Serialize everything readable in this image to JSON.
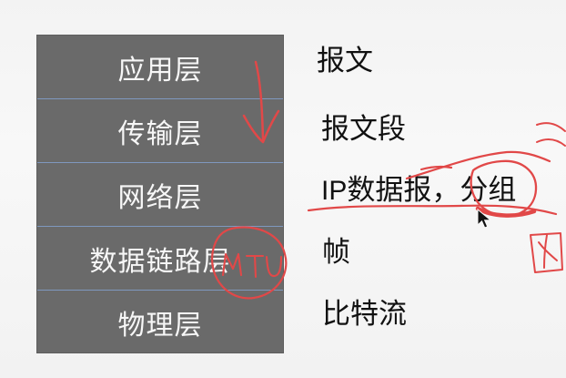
{
  "diagram": {
    "layers": [
      {
        "name": "应用层",
        "unit_text": "报文"
      },
      {
        "name": "传输层",
        "unit_text": "报文段"
      },
      {
        "name": "网络层",
        "unit_text": "IP数据报，分组",
        "unit_prefix": "IP",
        "unit_suffix": "数据报，分组"
      },
      {
        "name": "数据链路层",
        "unit_text": "帧"
      },
      {
        "name": "物理层",
        "unit_text": "比特流"
      }
    ]
  },
  "colors": {
    "layer_fill": "#6a6a6a",
    "layer_divider": "#7f98bf",
    "layer_text": "#f7f7f7",
    "unit_text": "#111111",
    "ink_red": "#e14848"
  },
  "icons": {
    "pointer": "mouse-pointer-icon"
  }
}
